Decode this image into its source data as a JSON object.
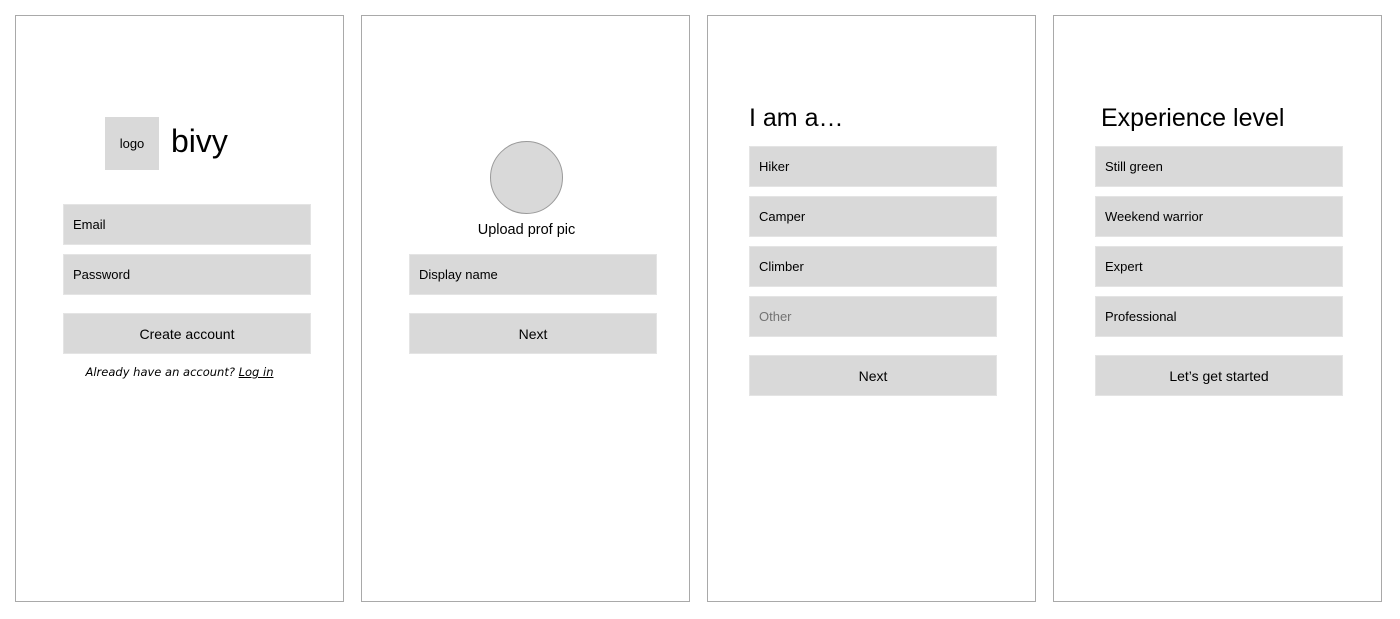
{
  "screen1": {
    "logo_label": "logo",
    "brand": "bivy",
    "email_placeholder": "Email",
    "password_placeholder": "Password",
    "create_button": "Create account",
    "login_prompt": "Already have an account?",
    "login_link": "Log in"
  },
  "screen2": {
    "upload_label": "Upload prof pic",
    "display_name_placeholder": "Display name",
    "next_button": "Next"
  },
  "screen3": {
    "heading": "I am a…",
    "options": [
      "Hiker",
      "Camper",
      "Climber"
    ],
    "other_placeholder": "Other",
    "next_button": "Next"
  },
  "screen4": {
    "heading": "Experience level",
    "options": [
      "Still green",
      "Weekend warrior",
      "Expert",
      "Professional"
    ],
    "start_button": "Let’s get started"
  }
}
